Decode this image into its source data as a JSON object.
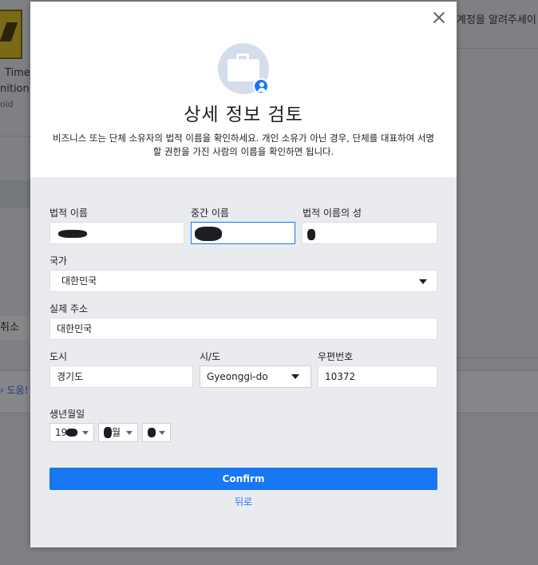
{
  "background": {
    "app_title_line1": "Timer",
    "app_title_line2": "nition",
    "app_platform": "oid",
    "right_text": "계정을 알려주세이",
    "cancel_label": "취소",
    "help_label": "도움!"
  },
  "modal": {
    "title": "상세 정보 검토",
    "description": "비즈니스 또는 단체 소유자의 법적 이름을 확인하세요. 개인 소유가 아닌 경우, 단체를 대표하여 서명할 권한을 가진 사람의 이름을 확인하면 됩니다.",
    "labels": {
      "legal_name": "법적 이름",
      "middle_name": "중간 이름",
      "last_name": "법적 이름의 성",
      "country": "국가",
      "address": "실제 주소",
      "city": "도시",
      "state": "시/도",
      "zip": "우편번호",
      "birthdate": "생년월일"
    },
    "values": {
      "country": "대한민국",
      "address": "대한민국",
      "city": "경기도",
      "state": "Gyeonggi-do",
      "zip": "10372",
      "birth_year": "19",
      "birth_month": "월"
    },
    "confirm_label": "Confirm",
    "back_label": "뒤로"
  },
  "colors": {
    "accent": "#1877f2",
    "overlay": "#7f8083",
    "panel": "#e9ebee"
  }
}
